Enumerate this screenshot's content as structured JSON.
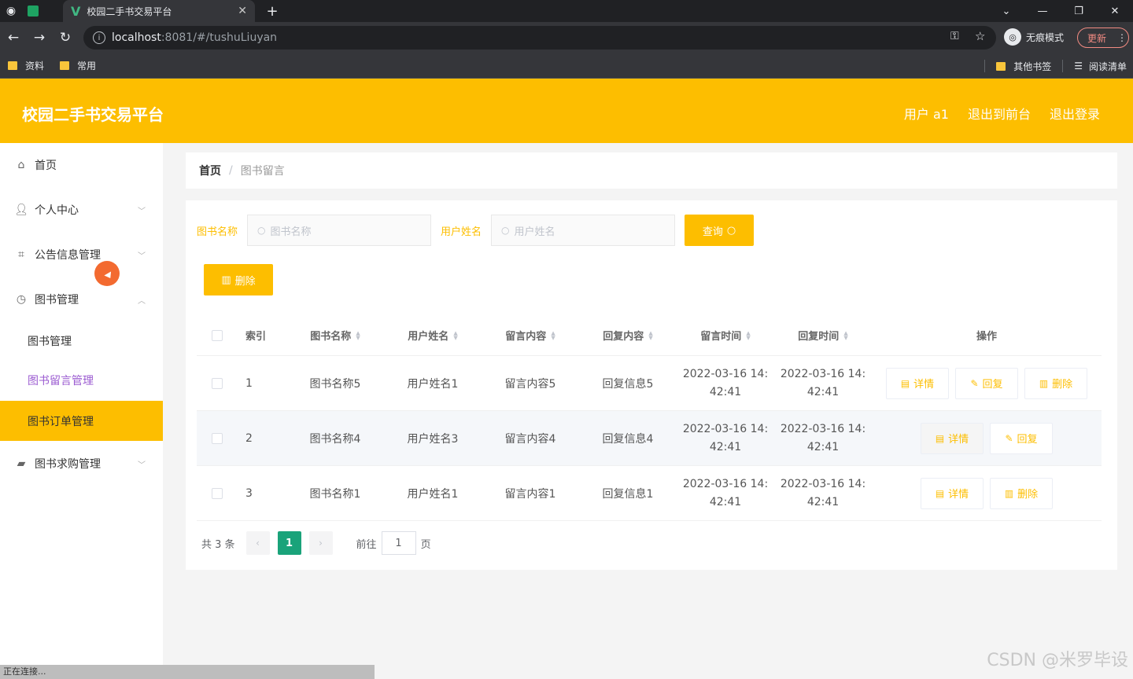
{
  "browser": {
    "tab_title": "校园二手书交易平台",
    "url_host": "localhost",
    "url_path": ":8081/#/tushuLiuyan",
    "incognito_label": "无痕模式",
    "update_label": "更新",
    "bookmarks": [
      "资料",
      "常用"
    ],
    "bookmarks_right": [
      "其他书签",
      "阅读清单"
    ]
  },
  "header": {
    "title": "校园二手书交易平台",
    "nav": [
      "用户 a1",
      "退出到前台",
      "退出登录"
    ]
  },
  "sidebar": {
    "items": [
      {
        "label": "首页",
        "icon": "home-icon"
      },
      {
        "label": "个人中心",
        "icon": "user-icon"
      },
      {
        "label": "公告信息管理",
        "icon": "crop-icon"
      },
      {
        "label": "图书管理",
        "icon": "clock-icon"
      },
      {
        "label": "图书求购管理",
        "icon": "ticket-icon"
      }
    ],
    "sub_items": [
      "图书管理",
      "图书留言管理",
      "图书订单管理"
    ]
  },
  "breadcrumb": {
    "home": "首页",
    "sep": "/",
    "current": "图书留言"
  },
  "search": {
    "book_label": "图书名称",
    "book_placeholder": "图书名称",
    "user_label": "用户姓名",
    "user_placeholder": "用户姓名",
    "query_label": "查询",
    "delete_label": "删除"
  },
  "table": {
    "headers": [
      "索引",
      "图书名称",
      "用户姓名",
      "留言内容",
      "回复内容",
      "留言时间",
      "回复时间",
      "操作"
    ],
    "rows": [
      {
        "idx": "1",
        "book": "图书名称5",
        "user": "用户姓名1",
        "msg": "留言内容5",
        "reply": "回复信息5",
        "msg_time_a": "2022-03-16 14:",
        "msg_time_b": "42:41",
        "reply_time_a": "2022-03-16 14:",
        "reply_time_b": "42:41"
      },
      {
        "idx": "2",
        "book": "图书名称4",
        "user": "用户姓名3",
        "msg": "留言内容4",
        "reply": "回复信息4",
        "msg_time_a": "2022-03-16 14:",
        "msg_time_b": "42:41",
        "reply_time_a": "2022-03-16 14:",
        "reply_time_b": "42:41"
      },
      {
        "idx": "3",
        "book": "图书名称1",
        "user": "用户姓名1",
        "msg": "留言内容1",
        "reply": "回复信息1",
        "msg_time_a": "2022-03-16 14:",
        "msg_time_b": "42:41",
        "reply_time_a": "2022-03-16 14:",
        "reply_time_b": "42:41"
      }
    ],
    "op_detail": "详情",
    "op_reply": "回复",
    "op_delete": "删除"
  },
  "pagination": {
    "total": "共 3 条",
    "current": "1",
    "goto_label": "前往",
    "goto_value": "1",
    "page_suffix": "页"
  },
  "status_text": "正在连接...",
  "watermark": "CSDN @米罗毕设",
  "colors": {
    "accent": "#fdbe00",
    "active_page": "#1aa37a",
    "submenu_active_text": "#9b5bd1"
  }
}
